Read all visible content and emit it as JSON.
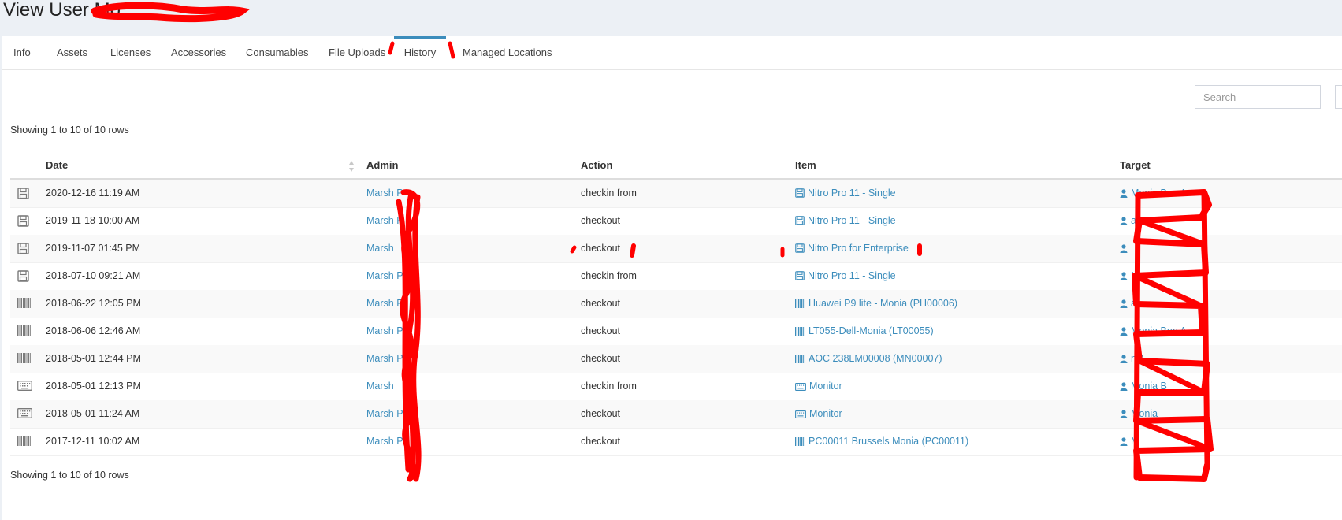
{
  "header": {
    "title": "View User Mo"
  },
  "tabs": [
    {
      "label": "Info"
    },
    {
      "label": "Assets"
    },
    {
      "label": "Licenses"
    },
    {
      "label": "Accessories"
    },
    {
      "label": "Consumables"
    },
    {
      "label": "File Uploads"
    },
    {
      "label": "History",
      "active": true
    },
    {
      "label": "Managed Locations"
    }
  ],
  "search": {
    "placeholder": "Search"
  },
  "pagination": {
    "top": "Showing 1 to 10 of 10 rows",
    "bottom": "Showing 1 to 10 of 10 rows"
  },
  "table": {
    "columns": [
      "Date",
      "Admin",
      "Action",
      "Item",
      "Target"
    ],
    "rows": [
      {
        "type_icon": "save-icon",
        "date": "2020-12-16 11:19 AM",
        "admin": "Marsh P",
        "action": "checkin from",
        "item_icon": "save-icon",
        "item": "Nitro Pro 11 - Single",
        "target": "Monia Ben A"
      },
      {
        "type_icon": "save-icon",
        "date": "2019-11-18 10:00 AM",
        "admin": "Marsh P",
        "action": "checkout",
        "item_icon": "save-icon",
        "item": "Nitro Pro 11 - Single",
        "target": "a"
      },
      {
        "type_icon": "save-icon",
        "date": "2019-11-07 01:45 PM",
        "admin": "Marsh",
        "action": "checkout",
        "item_icon": "save-icon",
        "item": "Nitro Pro for Enterprise",
        "target": ""
      },
      {
        "type_icon": "save-icon",
        "date": "2018-07-10 09:21 AM",
        "admin": "Marsh P",
        "action": "checkin from",
        "item_icon": "save-icon",
        "item": "Nitro Pro 11 - Single",
        "target": "Mo"
      },
      {
        "type_icon": "barcode-icon",
        "date": "2018-06-22 12:05 PM",
        "admin": "Marsh P",
        "action": "checkout",
        "item_icon": "barcode-icon",
        "item": "Huawei P9 lite - Monia (PH00006)",
        "target": "a"
      },
      {
        "type_icon": "barcode-icon",
        "date": "2018-06-06 12:46 AM",
        "admin": "Marsh P",
        "action": "checkout",
        "item_icon": "barcode-icon",
        "item": "LT055-Dell-Monia (LT00055)",
        "target": "Monia Ben A"
      },
      {
        "type_icon": "barcode-icon",
        "date": "2018-05-01 12:44 PM",
        "admin": "Marsh P",
        "action": "checkout",
        "item_icon": "barcode-icon",
        "item": "AOC 238LM00008 (MN00007)",
        "target": "n A"
      },
      {
        "type_icon": "keyboard-icon",
        "date": "2018-05-01 12:13 PM",
        "admin": "Marsh",
        "action": "checkin from",
        "item_icon": "keyboard-icon",
        "item": "Monitor",
        "target": "Monia B"
      },
      {
        "type_icon": "keyboard-icon",
        "date": "2018-05-01 11:24 AM",
        "admin": "Marsh P",
        "action": "checkout",
        "item_icon": "keyboard-icon",
        "item": "Monitor",
        "target": "Monia"
      },
      {
        "type_icon": "barcode-icon",
        "date": "2017-12-11 10:02 AM",
        "admin": "Marsh P",
        "action": "checkout",
        "item_icon": "barcode-icon",
        "item": "PC00011 Brussels Monia (PC00011)",
        "target": "M"
      }
    ]
  },
  "colors": {
    "link": "#3c8dbc",
    "active_tab_border": "#3c8dbc",
    "redaction": "#ff0000",
    "page_background": "#ecf0f5"
  }
}
